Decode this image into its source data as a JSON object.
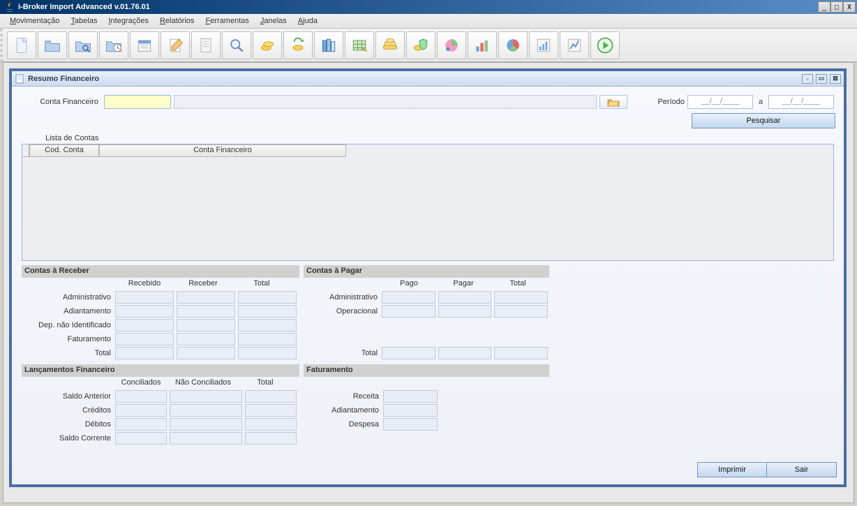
{
  "window": {
    "title": "i-Broker Import Advanced v.01.76.01"
  },
  "menu": {
    "movimentacao": "Movimentação",
    "tabelas": "Tabelas",
    "integracoes": "Integrações",
    "relatorios": "Relatórios",
    "ferramentas": "Ferramentas",
    "janelas": "Janelas",
    "ajuda": "Ajuda"
  },
  "toolbar_icons": [
    "document-icon",
    "folder-icon",
    "folder-search-icon",
    "folder-clock-icon",
    "calendar-icon",
    "notepad-icon",
    "sheet-icon",
    "magnifier-icon",
    "coins-icon",
    "coins-sync-icon",
    "books-icon",
    "spreadsheet-icon",
    "money-stack-icon",
    "money-shield-icon",
    "pie-people-icon",
    "bar-chart-icon",
    "pie-chart-icon",
    "column-chart-icon",
    "triangle-chart-icon",
    "play-icon"
  ],
  "inner": {
    "title": "Resumo Financeiro",
    "conta_label": "Conta Financeiro",
    "periodo_label": "Período",
    "date1": "__/__/____",
    "date_sep": "a",
    "date2": "__/__/____",
    "search": "Pesquisar",
    "lista_label": "Lista de Contas",
    "th_cod": "Cod. Conta",
    "th_conta": "Conta Financeiro"
  },
  "receber": {
    "title": "Contas à Receber",
    "cols": {
      "c1": "Recebido",
      "c2": "Receber",
      "c3": "Total"
    },
    "rows": {
      "r1": "Administrativo",
      "r2": "Adiantamento",
      "r3": "Dep. não Identificado",
      "r4": "Faturamento",
      "r5": "Total"
    }
  },
  "pagar": {
    "title": "Contas à Pagar",
    "cols": {
      "c1": "Pago",
      "c2": "Pagar",
      "c3": "Total"
    },
    "rows": {
      "r1": "Administrativo",
      "r2": "Operacional",
      "r5": "Total"
    }
  },
  "lanc": {
    "title": "Lançamentos Financeiro",
    "cols": {
      "c1": "Conciliados",
      "c2": "Não Conciliados",
      "c3": "Total"
    },
    "rows": {
      "r1": "Saldo Anterior",
      "r2": "Créditos",
      "r3": "Débitos",
      "r4": "Saldo Corrente"
    }
  },
  "fat": {
    "title": "Faturamento",
    "rows": {
      "r1": "Receita",
      "r2": "Adiantamento",
      "r3": "Despesa"
    }
  },
  "footer": {
    "print": "Imprimir",
    "exit": "Sair"
  }
}
